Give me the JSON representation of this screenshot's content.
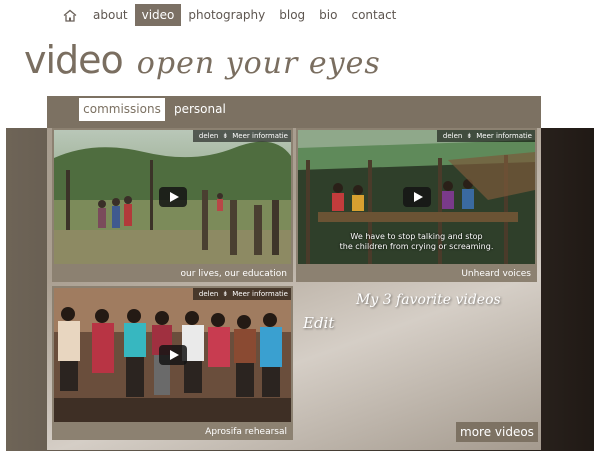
{
  "nav": {
    "home_icon": "home-icon",
    "items": [
      {
        "label": "about"
      },
      {
        "label": "video"
      },
      {
        "label": "photography"
      },
      {
        "label": "blog"
      },
      {
        "label": "bio"
      },
      {
        "label": "contact"
      }
    ],
    "active": "video"
  },
  "heading": {
    "title": "video",
    "tagline": "open your eyes"
  },
  "tabs": {
    "active_label": "commissions",
    "other_label": "personal"
  },
  "videos": [
    {
      "caption": "our lives, our education",
      "share_label": "delen",
      "info_label": "Meer informatie"
    },
    {
      "caption": "Unheard voices",
      "share_label": "delen",
      "info_label": "Meer informatie",
      "subtitle_line1": "We have to stop talking and stop",
      "subtitle_line2": "the children from crying or screaming."
    },
    {
      "caption": "Aprosifa rehearsal",
      "share_label": "delen",
      "info_label": "Meer informatie"
    }
  ],
  "favorites_text": "My 3 favorite videos",
  "edit_label": "Edit",
  "more_label": "more videos",
  "colors": {
    "accent": "#7b7064",
    "panel": "#a89d8f",
    "dark_band": "#201915"
  }
}
